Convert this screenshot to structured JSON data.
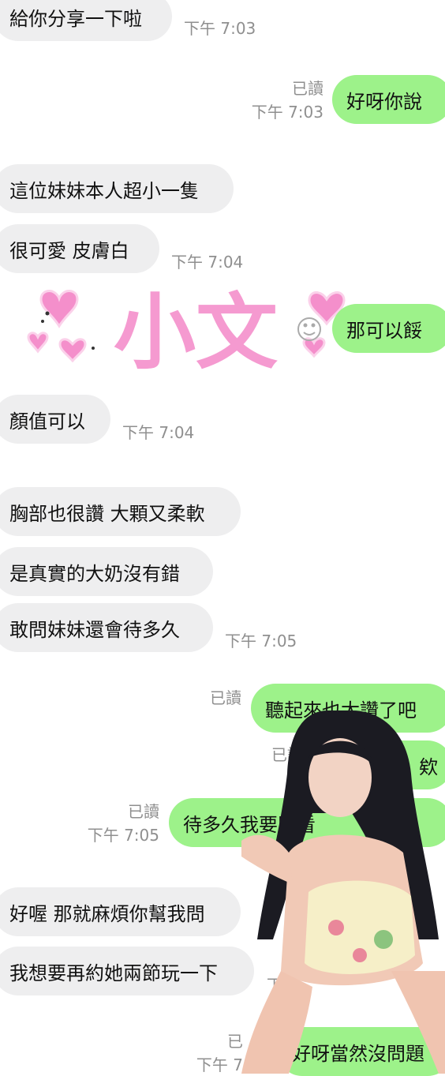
{
  "chat": {
    "m1": {
      "text": "給你分享一下啦",
      "time": "下午 7:03"
    },
    "m2": {
      "text": "好呀你說",
      "read": "已讀",
      "time": "下午 7:03"
    },
    "m3": {
      "text": "這位妹妹本人超小一隻"
    },
    "m4": {
      "text": "很可愛 皮膚白",
      "time": "下午 7:04"
    },
    "sticker": {
      "text": "小文"
    },
    "m5": {
      "text": "那可以餒"
    },
    "m6": {
      "text": "顏值可以",
      "time": "下午 7:04"
    },
    "m7": {
      "text": "胸部也很讚 大顆又柔軟"
    },
    "m8": {
      "text": "是真實的大奶沒有錯"
    },
    "m9": {
      "text": "敢問妹妹還會待多久",
      "time": "下午 7:05"
    },
    "m10": {
      "text": "聽起來也太讚了吧",
      "read": "已讀"
    },
    "m11": {
      "text": "欸",
      "read": "已讀"
    },
    "m12": {
      "text": "待多久我要問看",
      "read": "已讀",
      "time": "下午 7:05"
    },
    "m13": {
      "text": "好喔 那就麻煩你幫我問"
    },
    "m14": {
      "text": "我想要再約她兩節玩一下",
      "time_partial": "下"
    },
    "m15": {
      "text": "好呀當然沒問題",
      "read_partial": "已",
      "time_partial": "下午 7"
    }
  },
  "colors": {
    "incoming": "#eeeeef",
    "outgoing": "#9df28a",
    "meta": "#8f8f8f",
    "sticker_pink": "#f59ad0"
  }
}
